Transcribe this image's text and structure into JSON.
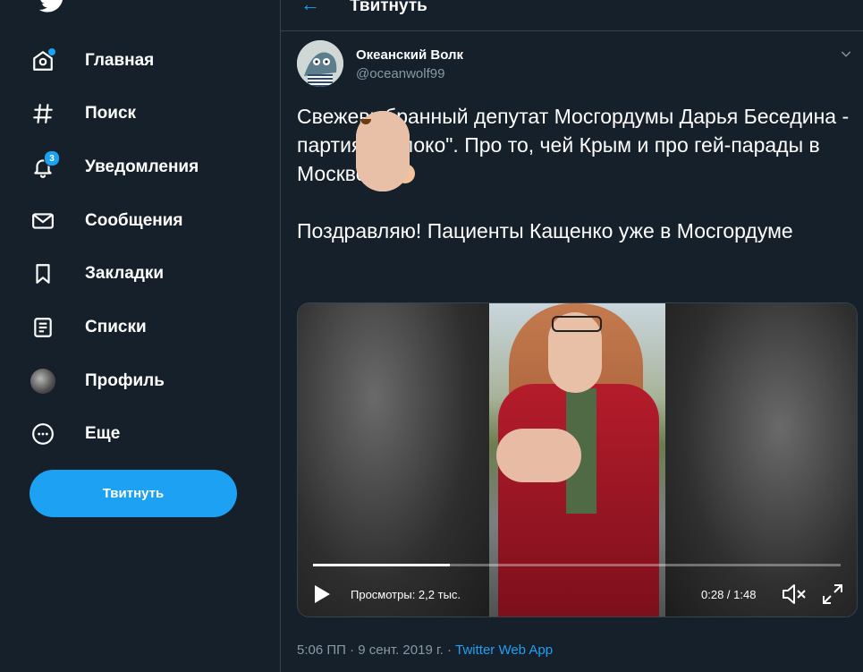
{
  "nav": {
    "items": [
      {
        "label": "Главная",
        "icon": "home-icon"
      },
      {
        "label": "Поиск",
        "icon": "hashtag-icon"
      },
      {
        "label": "Уведомления",
        "icon": "bell-icon",
        "badge": "3"
      },
      {
        "label": "Сообщения",
        "icon": "mail-icon"
      },
      {
        "label": "Закладки",
        "icon": "bookmark-icon"
      },
      {
        "label": "Списки",
        "icon": "list-icon"
      },
      {
        "label": "Профиль",
        "icon": "profile-avatar"
      },
      {
        "label": "Еще",
        "icon": "more-icon"
      }
    ],
    "tweet_button": "Твитнуть"
  },
  "header": {
    "title": "Твитнуть"
  },
  "tweet": {
    "author_name": "Океанский Волк",
    "author_handle": "@oceanwolf99",
    "text_line1": "Свежевыбранный депутат Мосгордумы Дарья Беседина - партия \"Яблоко\".  Про то, чей Крым и про гей-парады в Москве....",
    "text_line2": "Поздравляю! Пациенты Кащенко уже в Мосгордуме",
    "video": {
      "views": "Просмотры: 2,2 тыс.",
      "time": "0:28 / 1:48",
      "progress": 0.26
    },
    "timestamp": "5:06 ПП · 9 сент. 2019 г. · ",
    "source_app": "Twitter Web App"
  },
  "colors": {
    "background": "#15202b",
    "accent": "#1da1f2",
    "muted": "#8899a6",
    "border": "#38444d"
  }
}
